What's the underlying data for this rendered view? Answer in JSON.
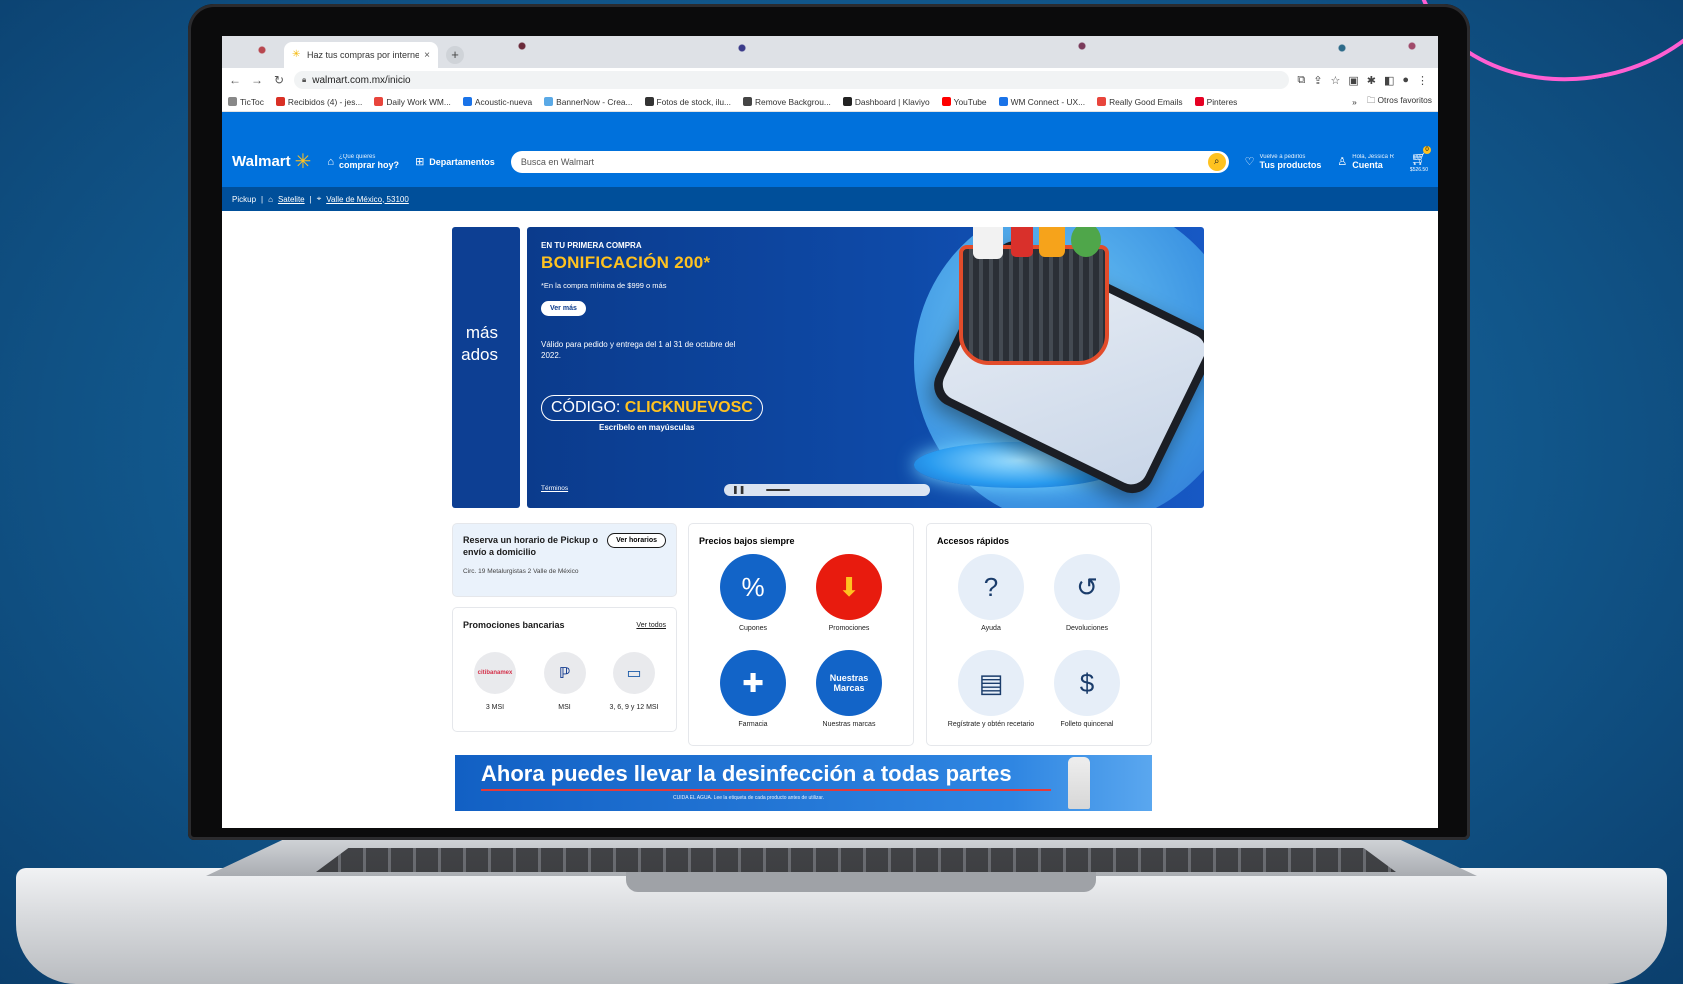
{
  "browser": {
    "tab_title": "Haz tus compras por internet",
    "tab_close": "×",
    "new_tab": "+",
    "url": "walmart.com.mx/inicio",
    "bookmarks": [
      {
        "label": "TicToc",
        "color": "#888888"
      },
      {
        "label": "Recibidos (4) - jes...",
        "color": "#d93025"
      },
      {
        "label": "Daily Work WM...",
        "color": "#e8453c"
      },
      {
        "label": "Acoustic-nueva",
        "color": "#1a73e8"
      },
      {
        "label": "BannerNow - Crea...",
        "color": "#5aa9e6"
      },
      {
        "label": "Fotos de stock, ilu...",
        "color": "#333333"
      },
      {
        "label": "Remove Backgrou...",
        "color": "#444444"
      },
      {
        "label": "Dashboard | Klaviyo",
        "color": "#222222"
      },
      {
        "label": "YouTube",
        "color": "#ff0000"
      },
      {
        "label": "WM Connect - UX...",
        "color": "#1a73e8"
      },
      {
        "label": "Really Good Emails",
        "color": "#e8453c"
      },
      {
        "label": "Pinteres",
        "color": "#e60023"
      }
    ],
    "bookmarks_more": "»",
    "other_bookmarks": "Otros favoritos"
  },
  "header": {
    "logo": "Walmart",
    "shop_small": "¿Qué quieres",
    "shop_big": "comprar hoy?",
    "departments": "Departamentos",
    "search_placeholder": "Busca en Walmart",
    "reorder_small": "Vuelve a pedirlos",
    "reorder_big": "Tus productos",
    "account_small": "Hola, Jessica R",
    "account_big": "Cuenta",
    "cart_count": "0",
    "cart_amount": "$526.50"
  },
  "subbar": {
    "mode": "Pickup",
    "store": "Satelite",
    "location": "Valle de México, 53100"
  },
  "hero": {
    "prev_line1": "más",
    "prev_line2": "ados",
    "kicker": "EN TU PRIMERA COMPRA",
    "title": "BONIFICACIÓN 200*",
    "fine_print": "*En la compra mínima de $999 o más",
    "cta": "Ver más",
    "validity": "Válido para pedido y entrega del 1 al 31 de octubre del 2022.",
    "code_prefix": "CÓDIGO:",
    "code": "CLICKNUEVOSC",
    "code_note": "Escríbelo en mayúsculas",
    "terms": "Términos"
  },
  "pickup_card": {
    "title": "Reserva un horario de Pickup o envío a domicilio",
    "address": "Circ. 19 Metalurgistas 2 Valle de México",
    "button": "Ver horarios"
  },
  "bank_card": {
    "title": "Promociones bancarias",
    "link": "Ver todos",
    "banks": [
      {
        "logo": "citibanamex",
        "label": "3 MSI"
      },
      {
        "logo": "PayPal",
        "label": "MSI"
      },
      {
        "logo": "card-icon",
        "label": "3, 6, 9 y 12 MSI"
      }
    ]
  },
  "precios": {
    "title": "Precios bajos siempre",
    "items": [
      {
        "label": "Cupones",
        "icon": "coupon-icon"
      },
      {
        "label": "Promociones",
        "icon": "down-arrow-icon"
      },
      {
        "label": "Farmacia",
        "icon": "pharmacy-icon"
      },
      {
        "label": "Nuestras marcas",
        "icon": "nuestras-marcas-logo",
        "logo_text": "Nuestras Marcas"
      }
    ]
  },
  "accesos": {
    "title": "Accesos rápidos",
    "items": [
      {
        "label": "Ayuda",
        "icon": "help-icon"
      },
      {
        "label": "Devoluciones",
        "icon": "returns-icon"
      },
      {
        "label": "Regístrate y obtén recetario",
        "icon": "recipe-book-icon"
      },
      {
        "label": "Folleto quincenal",
        "icon": "flyer-icon"
      }
    ]
  },
  "banner": {
    "headline": "Ahora puedes llevar la desinfección a todas partes",
    "disclaimer": "CUIDA EL AGUA. Lee la etiqueta de cada producto antes de utilizar."
  }
}
